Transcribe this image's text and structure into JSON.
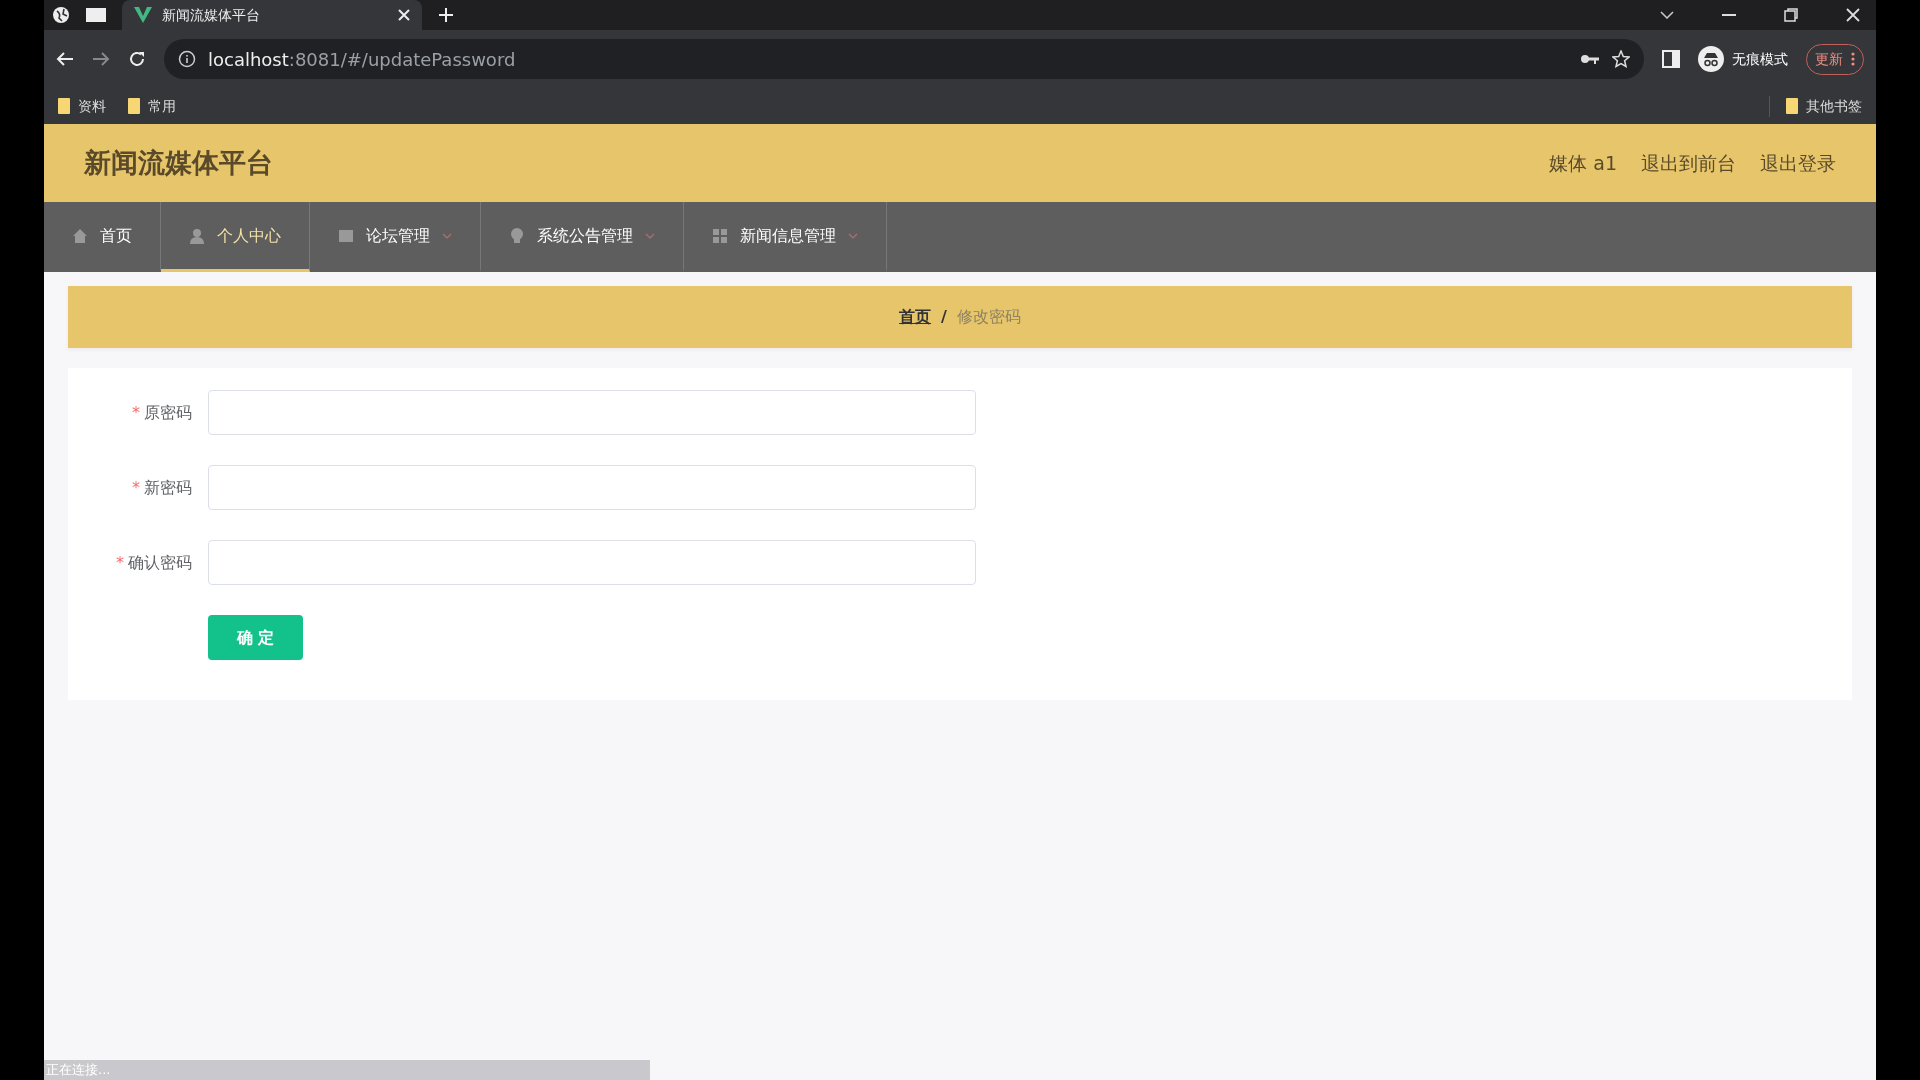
{
  "browser": {
    "tab_title": "新闻流媒体平台",
    "address_host": "localhost",
    "address_path": ":8081/#/updatePassword",
    "incognito_label": "无痕模式",
    "update_button": "更新",
    "bookmarks": [
      "资料",
      "常用"
    ],
    "other_bookmarks": "其他书签"
  },
  "header": {
    "title": "新闻流媒体平台",
    "user": "媒体 a1",
    "links": [
      "退出到前台",
      "退出登录"
    ]
  },
  "nav": [
    {
      "label": "首页",
      "dropdown": false,
      "selected": false
    },
    {
      "label": "个人中心",
      "dropdown": false,
      "selected": true
    },
    {
      "label": "论坛管理",
      "dropdown": true,
      "selected": false
    },
    {
      "label": "系统公告管理",
      "dropdown": true,
      "selected": false
    },
    {
      "label": "新闻信息管理",
      "dropdown": true,
      "selected": false
    }
  ],
  "breadcrumb": {
    "items": [
      "首页",
      "修改密码"
    ],
    "separator": "/"
  },
  "form": {
    "fields": [
      {
        "label": "原密码",
        "required_mark": "*"
      },
      {
        "label": "新密码",
        "required_mark": "*"
      },
      {
        "label": "确认密码",
        "required_mark": "*"
      }
    ],
    "submit": "确 定"
  },
  "status_bar": "正在连接..."
}
